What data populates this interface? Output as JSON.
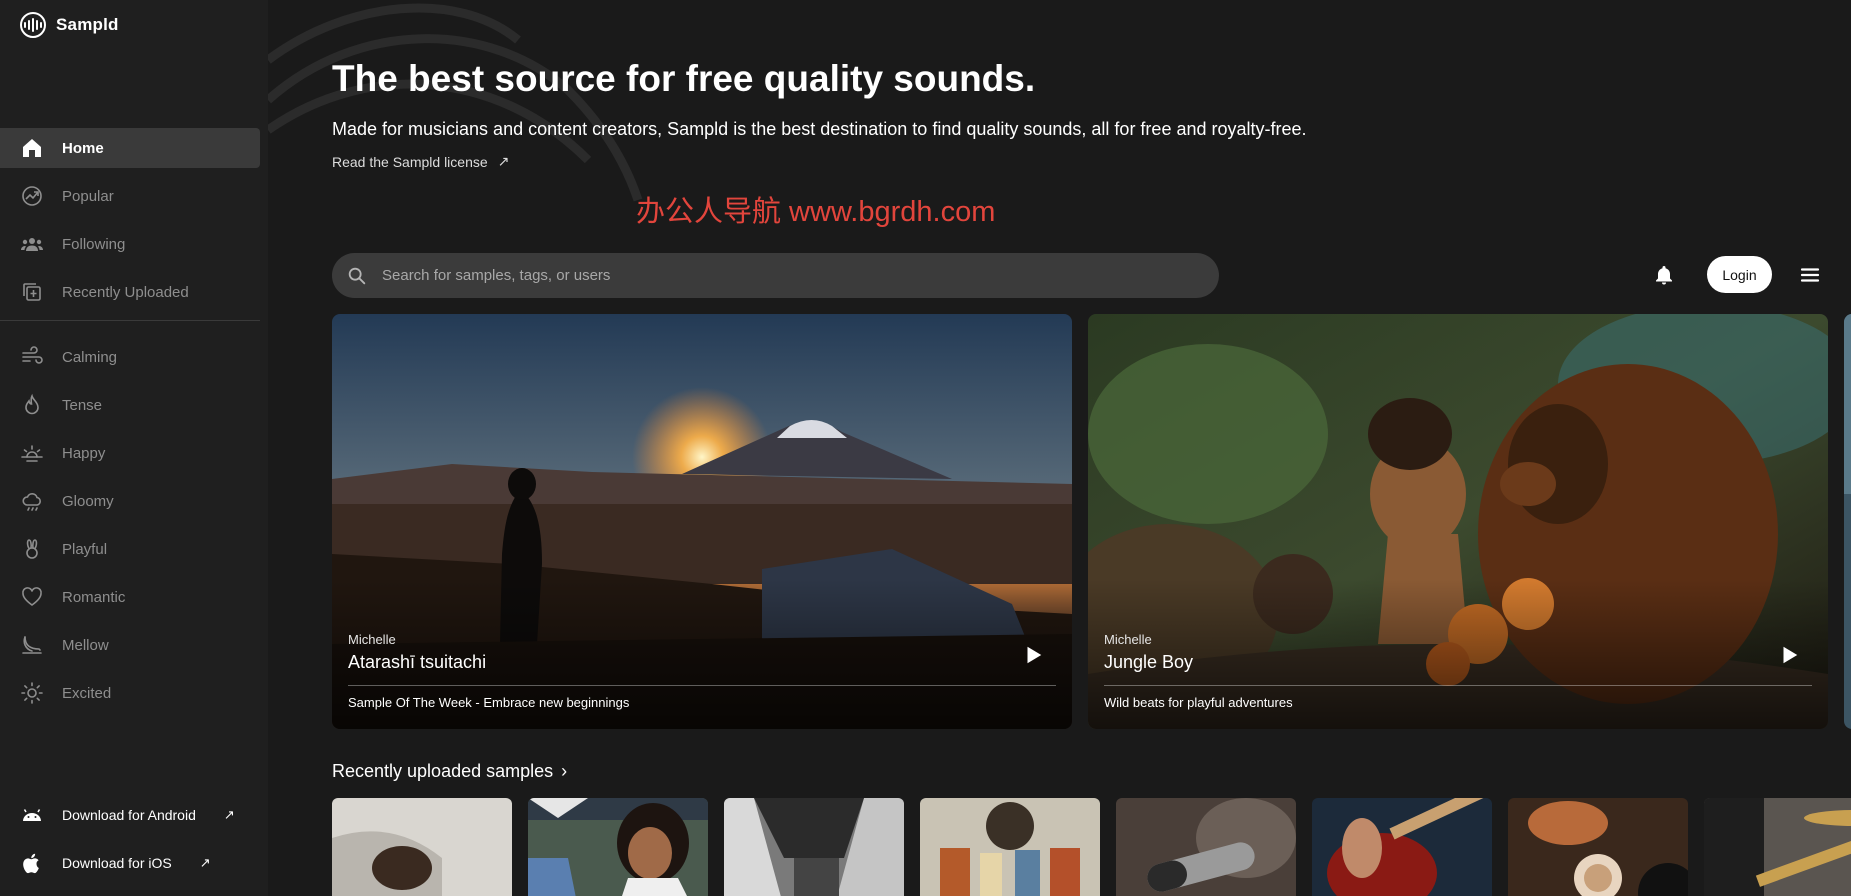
{
  "app": {
    "name": "Sampld"
  },
  "sidebar": {
    "primary": [
      {
        "label": "Home",
        "icon": "home-icon",
        "active": true
      },
      {
        "label": "Popular",
        "icon": "trending-icon"
      },
      {
        "label": "Following",
        "icon": "people-icon"
      },
      {
        "label": "Recently Uploaded",
        "icon": "recent-upload-icon"
      }
    ],
    "moods": [
      {
        "label": "Calming",
        "icon": "wind-icon"
      },
      {
        "label": "Tense",
        "icon": "flame-icon"
      },
      {
        "label": "Happy",
        "icon": "sunrise-icon"
      },
      {
        "label": "Gloomy",
        "icon": "cloud-icon"
      },
      {
        "label": "Playful",
        "icon": "bunny-icon"
      },
      {
        "label": "Romantic",
        "icon": "heart-icon"
      },
      {
        "label": "Mellow",
        "icon": "moon-icon"
      },
      {
        "label": "Excited",
        "icon": "sun-icon"
      }
    ],
    "downloads": [
      {
        "label": "Download for Android",
        "icon": "android-icon"
      },
      {
        "label": "Download for iOS",
        "icon": "apple-icon"
      }
    ]
  },
  "hero": {
    "title": "The best source for free quality sounds.",
    "subtitle": "Made for musicians and content creators, Sampld is the best destination to find quality sounds, all for free and royalty-free.",
    "license_link": "Read the Sampld license",
    "watermark": "办公人导航 www.bgrdh.com"
  },
  "search": {
    "placeholder": "Search for samples, tags, or users"
  },
  "header": {
    "login_label": "Login"
  },
  "featured": [
    {
      "author": "Michelle",
      "title": "Atarashī tsuitachi",
      "description": "Sample Of The Week - Embrace new beginnings"
    },
    {
      "author": "Michelle",
      "title": "Jungle Boy",
      "description": "Wild beats for playful adventures"
    }
  ],
  "recent": {
    "title": "Recently uploaded samples",
    "thumbnails": [
      "person-lying",
      "smiling-woman",
      "building-bw",
      "guitar-shop",
      "microphone",
      "electric-guitar",
      "coffee-cups",
      "drummer"
    ]
  },
  "colors": {
    "background": "#1a1a1a",
    "sidebar": "#1f1f1f",
    "active_nav": "#3a3a3a",
    "search": "#3b3b3b",
    "watermark": "#e2453c"
  }
}
